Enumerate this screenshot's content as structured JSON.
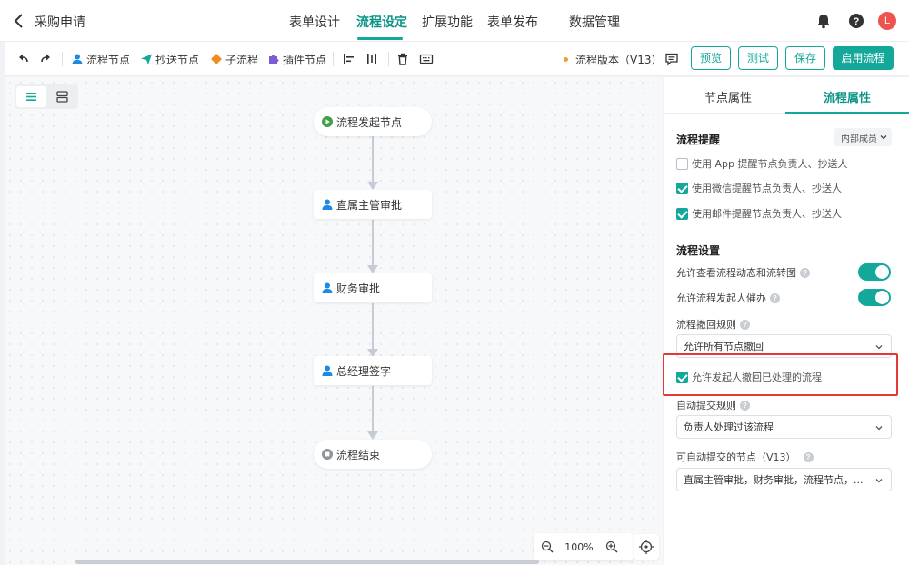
{
  "app": {
    "title": "采购申请"
  },
  "nav": {
    "tabs": [
      "表单设计",
      "流程设定",
      "扩展功能",
      "表单发布",
      "数据管理"
    ],
    "active_index": 1
  },
  "header_icons": [
    "bell-icon",
    "help-icon"
  ],
  "user": {
    "avatar_initial": "L",
    "avatar_color": "#ef5350"
  },
  "toolbar": {
    "items": [
      {
        "label": "流程节点",
        "icon": "user-node-icon",
        "color": "#1e88e5"
      },
      {
        "label": "抄送节点",
        "icon": "send-icon",
        "color": "#14a89a"
      },
      {
        "label": "子流程",
        "icon": "diamond-icon",
        "color": "#f08c1e"
      },
      {
        "label": "插件节点",
        "icon": "puzzle-icon",
        "color": "#7b5cd6"
      }
    ],
    "version_label": "流程版本（V13）",
    "buttons": {
      "preview": "预览",
      "test": "测试",
      "save": "保存",
      "enable": "启用流程"
    }
  },
  "canvas": {
    "nodes": [
      {
        "label": "流程发起节点",
        "type": "start"
      },
      {
        "label": "直属主管审批",
        "type": "approver"
      },
      {
        "label": "财务审批",
        "type": "approver"
      },
      {
        "label": "总经理签字",
        "type": "approver"
      },
      {
        "label": "流程结束",
        "type": "end"
      }
    ],
    "zoom": "100%"
  },
  "panel": {
    "tabs": [
      "节点属性",
      "流程属性"
    ],
    "active_tab": 1,
    "reminder": {
      "title": "流程提醒",
      "scope": "内部成员",
      "options": [
        {
          "label": "使用 App 提醒节点负责人、抄送人",
          "checked": false
        },
        {
          "label": "使用微信提醒节点负责人、抄送人",
          "checked": true
        },
        {
          "label": "使用邮件提醒节点负责人、抄送人",
          "checked": true
        }
      ]
    },
    "settings": {
      "title": "流程设置",
      "toggles": [
        {
          "label": "允许查看流程动态和流转图",
          "on": true
        },
        {
          "label": "允许流程发起人催办",
          "on": true
        }
      ],
      "revoke_rule_label": "流程撤回规则",
      "revoke_rule_value": "允许所有节点撤回",
      "allow_revoke_processed": {
        "label": "允许发起人撤回已处理的流程",
        "checked": true
      },
      "auto_submit_label": "自动提交规则",
      "auto_submit_value": "负责人处理过该流程",
      "auto_nodes_label": "可自动提交的节点（V13）",
      "auto_nodes_value": "直属主管审批，财务审批，流程节点，..."
    }
  },
  "colors": {
    "accent": "#14a89a",
    "highlight": "#e53935"
  }
}
